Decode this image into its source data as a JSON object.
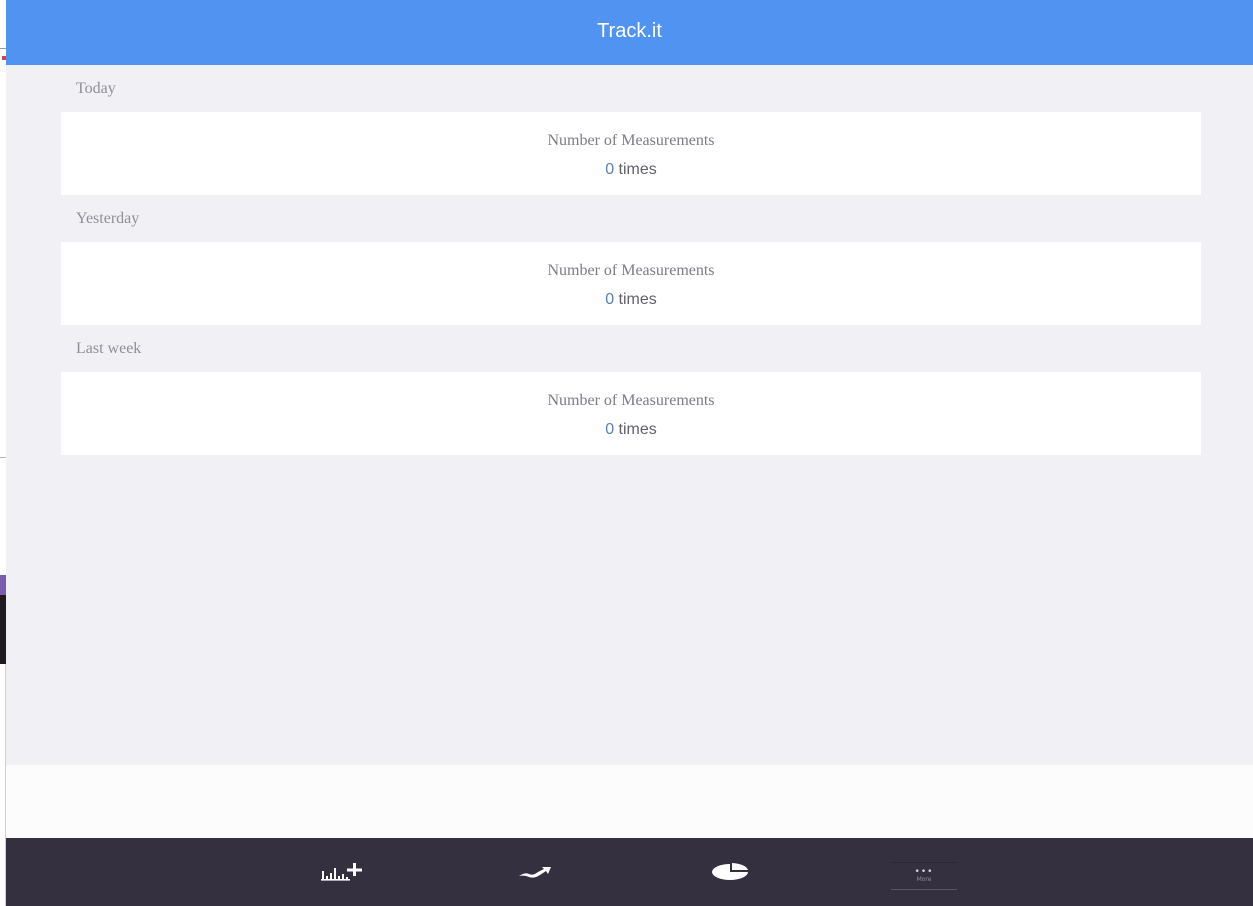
{
  "app": {
    "title": "Track.it"
  },
  "sections": [
    {
      "label": "Today",
      "metric_label": "Number of Measurements",
      "metric_count": "0",
      "metric_unit": " times"
    },
    {
      "label": "Yesterday",
      "metric_label": "Number of Measurements",
      "metric_count": "0",
      "metric_unit": " times"
    },
    {
      "label": "Last week",
      "metric_label": "Number of Measurements",
      "metric_count": "0",
      "metric_unit": " times"
    }
  ],
  "tabbar": {
    "tabs": [
      {
        "icon": "bar-chart-plus-icon"
      },
      {
        "icon": "trend-line-icon"
      },
      {
        "icon": "pie-chart-icon"
      },
      {
        "icon": "more-dots-icon",
        "label": "More"
      }
    ]
  },
  "colors": {
    "header": "#5193f0",
    "background": "#f1f1f5",
    "tabbar": "#35303f"
  }
}
